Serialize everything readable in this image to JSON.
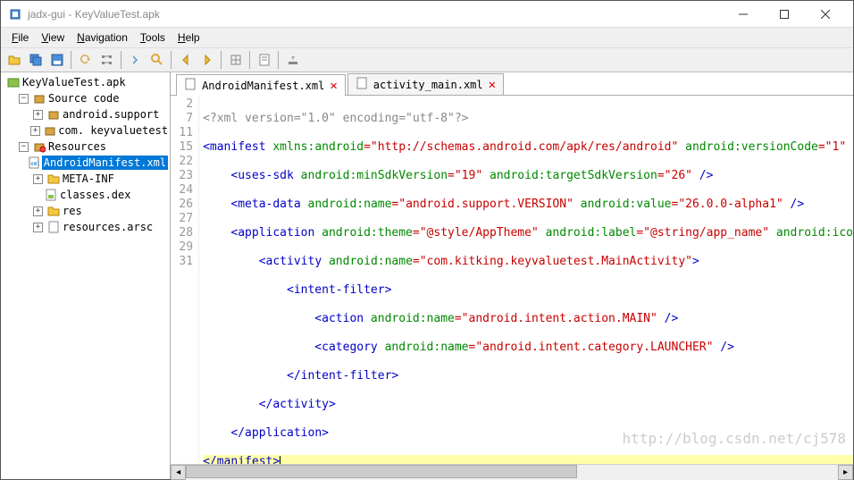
{
  "window": {
    "title": "jadx-gui - KeyValueTest.apk"
  },
  "menubar": {
    "file": "File",
    "view": "View",
    "navigation": "Navigation",
    "tools": "Tools",
    "help": "Help"
  },
  "tree": {
    "root": "KeyValueTest.apk",
    "source_code": "Source code",
    "android_support": "android.support",
    "com_keyvaluetest": "com.        keyvaluetest",
    "resources": "Resources",
    "manifest": "AndroidManifest.xml",
    "metainf": "META-INF",
    "classes_dex": "classes.dex",
    "res": "res",
    "resources_arsc": "resources.arsc"
  },
  "tabs": {
    "manifest": "AndroidManifest.xml",
    "activity_main": "activity_main.xml"
  },
  "gutter": [
    "2",
    "7",
    "11",
    "15",
    "22",
    "23",
    "24",
    "26",
    "27",
    "28",
    "29",
    "31"
  ],
  "code": {
    "l0": "<?xml version=\"1.0\" encoding=\"utf-8\"?>",
    "l1": {
      "pre": "<",
      "tag": "manifest",
      "a1": " xmlns:android",
      "v1": "=\"http://schemas.android.com/apk/res/android\"",
      "a2": " android:versionCode",
      "v2": "=\"1\""
    },
    "l2": {
      "sp": "    <",
      "tag": "uses-sdk",
      "a1": " android:minSdkVersion",
      "v1": "=\"19\"",
      "a2": " android:targetSdkVersion",
      "v2": "=\"26\"",
      "end": " />"
    },
    "l3": {
      "sp": "    <",
      "tag": "meta-data",
      "a1": " android:name",
      "v1": "=\"android.support.VERSION\"",
      "a2": " android:value",
      "v2": "=\"26.0.0-alpha1\"",
      "end": " />"
    },
    "l4": {
      "sp": "    <",
      "tag": "application",
      "a1": " android:theme",
      "v1": "=\"@style/AppTheme\"",
      "a2": " android:label",
      "v2": "=\"@string/app_name\"",
      "a3": " android:ico"
    },
    "l5": {
      "sp": "        <",
      "tag": "activity",
      "a1": " android:name",
      "v1": "=\"com.kitking.keyvaluetest.MainActivity\"",
      "end": ">"
    },
    "l6": {
      "sp": "            <",
      "tag": "intent-filter",
      "end": ">"
    },
    "l7": {
      "sp": "                <",
      "tag": "action",
      "a1": " android:name",
      "v1": "=\"android.intent.action.MAIN\"",
      "end": " />"
    },
    "l8": {
      "sp": "                <",
      "tag": "category",
      "a1": " android:name",
      "v1": "=\"android.intent.category.LAUNCHER\"",
      "end": " />"
    },
    "l9": {
      "sp": "            </",
      "tag": "intent-filter",
      "end": ">"
    },
    "l10": {
      "sp": "        </",
      "tag": "activity",
      "end": ">"
    },
    "l11": {
      "sp": "    </",
      "tag": "application",
      "end": ">"
    },
    "l12": {
      "sp": "</",
      "tag": "manifest",
      "end": ">"
    }
  },
  "watermark": "http://blog.csdn.net/cj578"
}
